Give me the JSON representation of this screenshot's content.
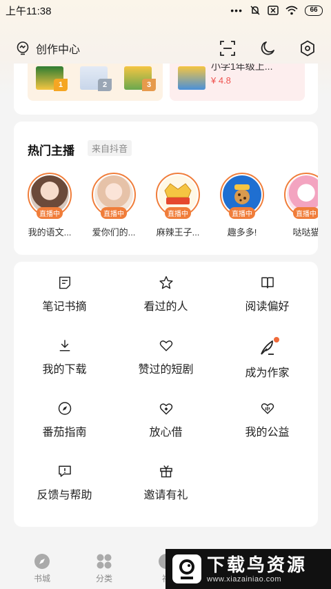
{
  "status_bar": {
    "time": "上午11:38",
    "battery": "66"
  },
  "header": {
    "creator_label": "创作中心"
  },
  "book_card": {
    "ranks": [
      "1",
      "2",
      "3"
    ],
    "right_title": "小学1年级上...",
    "right_score": "¥ 4.8"
  },
  "streamers": {
    "title": "热门主播",
    "source": "来自抖音",
    "live_label": "直播中",
    "items": [
      {
        "name": "我的语文..."
      },
      {
        "name": "爱你们的..."
      },
      {
        "name": "麻辣王子..."
      },
      {
        "name": "趣多多!"
      },
      {
        "name": "哒哒猫"
      }
    ]
  },
  "menu": {
    "items": [
      {
        "label": "笔记书摘",
        "icon": "note-icon"
      },
      {
        "label": "看过的人",
        "icon": "star-icon"
      },
      {
        "label": "阅读偏好",
        "icon": "book-open-icon"
      },
      {
        "label": "我的下载",
        "icon": "download-icon"
      },
      {
        "label": "赞过的短剧",
        "icon": "heart-icon"
      },
      {
        "label": "成为作家",
        "icon": "quill-icon"
      },
      {
        "label": "番茄指南",
        "icon": "compass-icon"
      },
      {
        "label": "放心借",
        "icon": "heart-shield-icon"
      },
      {
        "label": "我的公益",
        "icon": "charity-heart-icon"
      },
      {
        "label": "反馈与帮助",
        "icon": "feedback-icon"
      },
      {
        "label": "邀请有礼",
        "icon": "gift-icon"
      }
    ]
  },
  "bottom_nav": {
    "items": [
      {
        "label": "书城"
      },
      {
        "label": "分类"
      },
      {
        "label": "福"
      }
    ]
  },
  "watermark": {
    "title": "下载鸟资源",
    "url": "www.xiazainiao.com"
  },
  "colors": {
    "accent": "#f07d3a",
    "price": "#ef5350"
  }
}
